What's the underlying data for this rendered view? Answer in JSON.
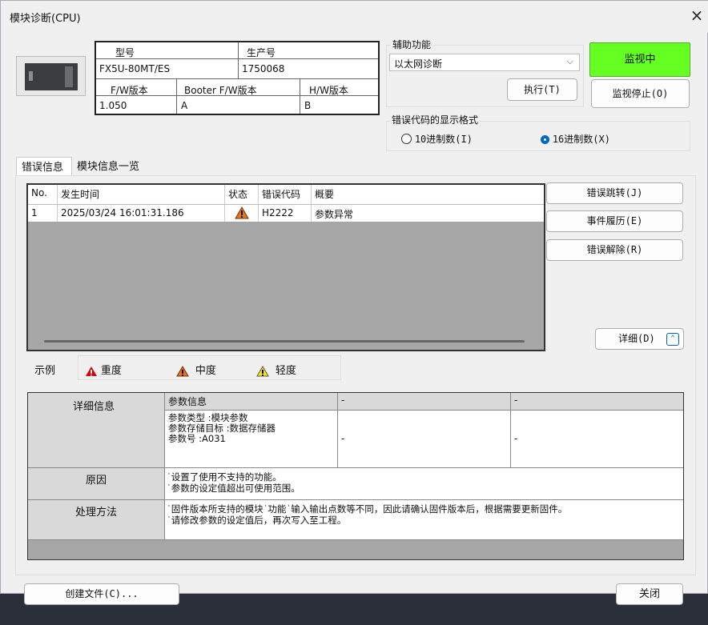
{
  "window": {
    "title": "模块诊断(CPU)",
    "close_glyph": "×"
  },
  "module_info": {
    "model_label": "型号",
    "serial_label": "生产号",
    "model_value": "FX5U-80MT/ES",
    "serial_value": "1750068",
    "fw_label": "F/W版本",
    "booter_label": "Booter F/W版本",
    "hw_label": "H/W版本",
    "fw_value": "1.050",
    "booter_value": "A",
    "hw_value": "B"
  },
  "aux": {
    "label": "辅助功能",
    "selected": "以太网诊断",
    "execute_button": "执行(T)"
  },
  "monitor": {
    "status_button": "监视中",
    "stop_button": "监视停止(O)",
    "status_color": "#66ff22"
  },
  "error_code_format": {
    "label": "错误代码的显示格式",
    "options": [
      "10进制数(I)",
      "16进制数(X)"
    ],
    "selected": "16进制数(X)"
  },
  "tabs": [
    "错误信息",
    "模块信息一览"
  ],
  "error_list": {
    "headers": [
      "No.",
      "发生时间",
      "状态",
      "错误代码",
      "概要"
    ],
    "rows": [
      {
        "no": "1",
        "time": "2025/03/24 16:01:31.186",
        "status_icon": "warning-icon-moderate",
        "code": "H2222",
        "summary": "参数异常"
      }
    ]
  },
  "side_buttons": {
    "jump": "错误跳转(J)",
    "history": "事件履历(E)",
    "clear": "错误解除(R)",
    "detail": "详细(D)",
    "collapse_icon": "double-chevron-up-icon"
  },
  "legend": {
    "label": "示例",
    "items": [
      {
        "icon": "warning-icon-red",
        "text": "重度"
      },
      {
        "icon": "warning-icon-orange",
        "text": "中度"
      },
      {
        "icon": "warning-icon-yellow",
        "text": "轻度"
      }
    ]
  },
  "detail": {
    "info_label": "详细信息",
    "col_headers": [
      "参数信息",
      "-",
      "-"
    ],
    "info_lines": [
      "参数类型 :模块参数",
      "参数存储目标 :数据存储器",
      "参数号 :A031"
    ],
    "col2": "-",
    "col3": "-",
    "cause_label": "原因",
    "cause_lines": [
      "˙设置了使用不支持的功能。",
      "˙参数的设定值超出可使用范围。"
    ],
    "remedy_label": "处理方法",
    "remedy_lines": [
      "˙固件版本所支持的模块˙功能˙输入输出点数等不同，因此请确认固件版本后，根据需要更新固件。",
      "˙请修改参数的设定值后，再次写入至工程。"
    ]
  },
  "footer": {
    "create_file": "创建文件(C)...",
    "close": "关闭"
  }
}
